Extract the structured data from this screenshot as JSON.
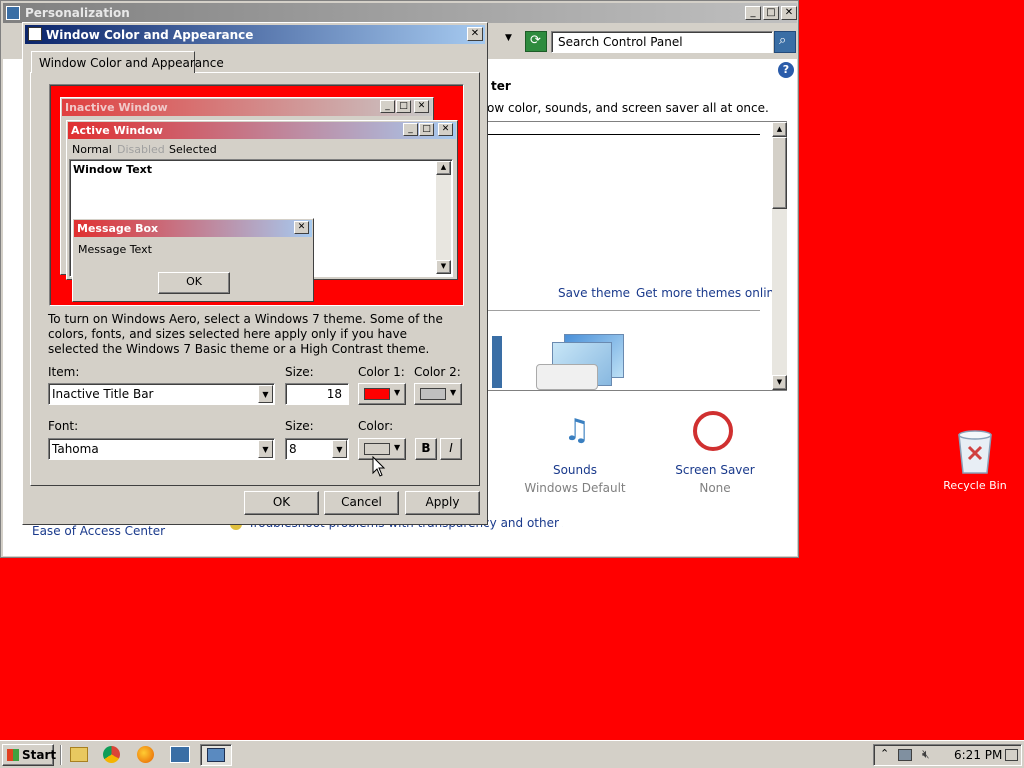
{
  "bg_window": {
    "title": "Personalization",
    "search_placeholder": "Search Control Panel",
    "heading_partial": "ter",
    "desc_partial": "ow color, sounds, and screen saver all at once.",
    "save_theme": "Save theme",
    "more_themes": "Get more themes online",
    "sounds_label": "Sounds",
    "sounds_value": "Windows Default",
    "screensaver_label": "Screen Saver",
    "screensaver_value": "None",
    "ease_access": "Ease of Access Center",
    "aero_link_partial": "Troubleshoot problems with transparency and other Aero effects"
  },
  "dialog": {
    "title": "Window Color and Appearance",
    "tab_label": "Window Color and Appearance",
    "preview": {
      "inactive_title": "Inactive Window",
      "active_title": "Active Window",
      "menu_normal": "Normal",
      "menu_disabled": "Disabled",
      "menu_selected": "Selected",
      "window_text": "Window Text",
      "msgbox_title": "Message Box",
      "msgbox_text": "Message Text",
      "msgbox_ok": "OK"
    },
    "info_text": "To turn on Windows Aero, select a Windows 7 theme.  Some of the colors, fonts, and sizes selected here apply only if you have selected the Windows 7 Basic theme or a High Contrast theme.",
    "item_label": "Item:",
    "item_value": "Inactive Title Bar",
    "size_label": "Size:",
    "size_value": "18",
    "color1_label": "Color 1:",
    "color2_label": "Color 2:",
    "font_label": "Font:",
    "font_value": "Tahoma",
    "font_size_label": "Size:",
    "font_size_value": "8",
    "font_color_label": "Color:",
    "bold_label": "B",
    "italic_label": "I",
    "ok": "OK",
    "cancel": "Cancel",
    "apply": "Apply"
  },
  "desktop": {
    "recycle_bin": "Recycle Bin"
  },
  "taskbar": {
    "start": "Start",
    "clock": "6:21 PM"
  },
  "colors": {
    "desktop": "#ff0000",
    "color1": "#ff0000",
    "color2": "#c0c0c0",
    "link": "#1a3a8c"
  }
}
